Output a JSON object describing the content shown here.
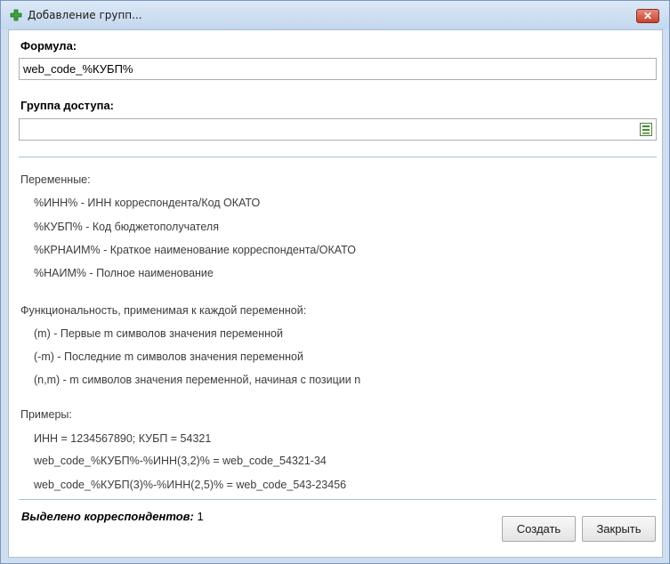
{
  "window": {
    "title": "Добавление групп..."
  },
  "formula": {
    "label": "Формула:",
    "value": "web_code_%КУБП%"
  },
  "access_group": {
    "label": "Группа доступа:",
    "value": ""
  },
  "variables": {
    "heading": "Переменные:",
    "items": [
      "%ИНН% - ИНН корреспондента/Код ОКАТО",
      "%КУБП% - Код бюджетополучателя",
      "%КРНАИМ% - Краткое наименование корреспондента/ОКАТО",
      "%НАИМ% - Полное наименование"
    ]
  },
  "functions": {
    "heading": "Функциональность, применимая к каждой переменной:",
    "items": [
      "(m) - Первые m символов значения переменной",
      "(-m) - Последние m символов значения переменной",
      "(n,m) - m символов значения переменной, начиная с позиции n"
    ]
  },
  "examples": {
    "heading": "Примеры:",
    "items": [
      "ИНН = 1234567890;  КУБП = 54321",
      "web_code_%КУБП%-%ИНН(3,2)%  =  web_code_54321-34",
      "web_code_%КУБП(3)%-%ИНН(2,5)%  =  web_code_543-23456"
    ]
  },
  "footer": {
    "selected_label": "Выделено корреспондентов:",
    "selected_count": "1"
  },
  "buttons": {
    "create": "Создать",
    "close": "Закрыть"
  },
  "colors": {
    "title_gradient_top": "#dbe8f6",
    "close_button": "#c8432f",
    "divider": "#a7c0dc",
    "add_icon": "#3aa33a"
  }
}
